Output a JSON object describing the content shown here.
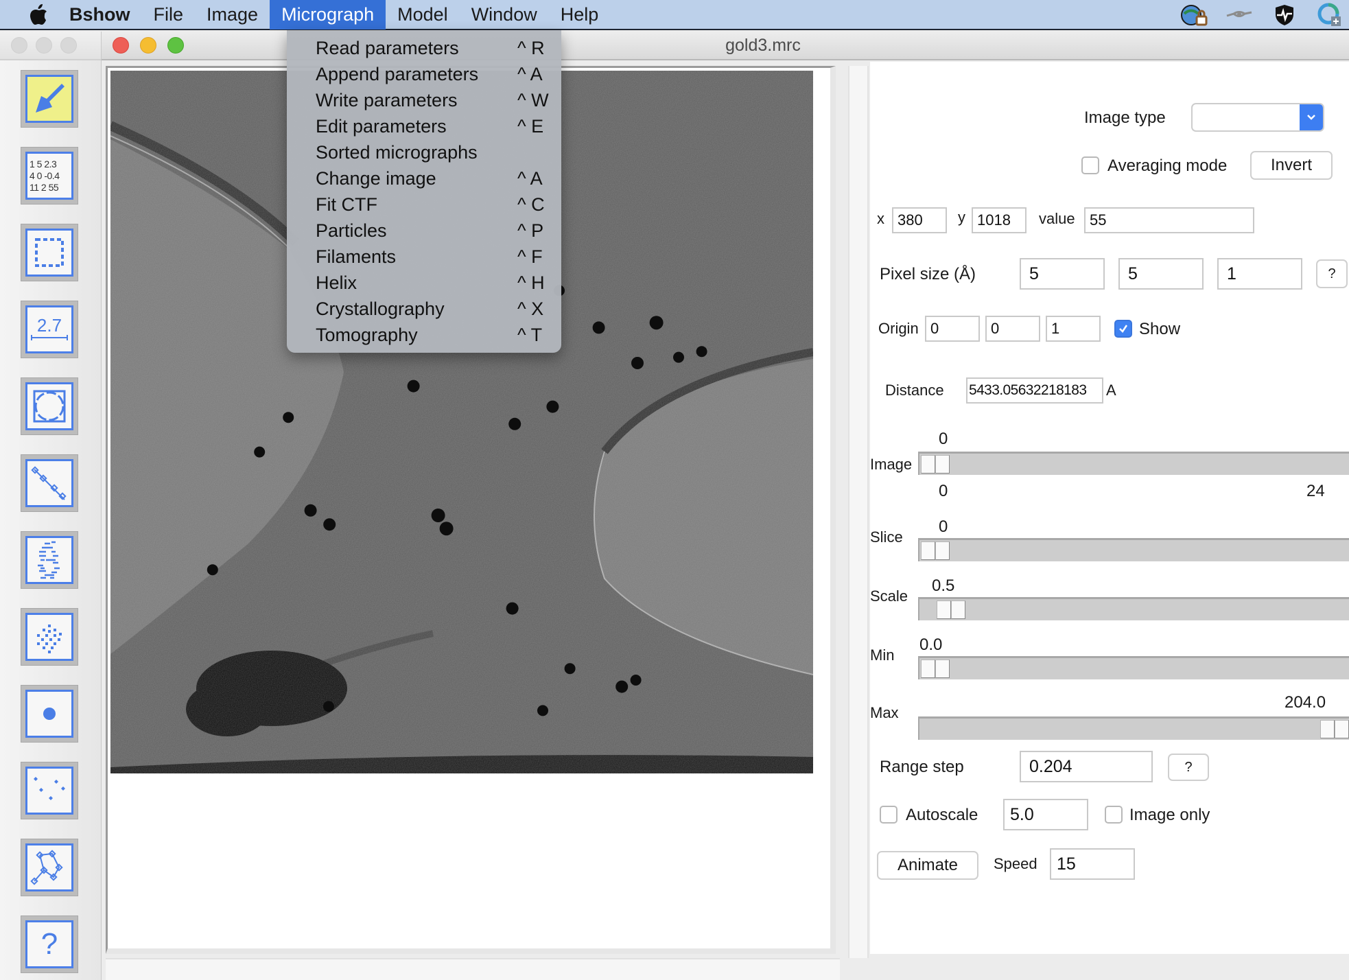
{
  "menubar": {
    "app_name": "Bshow",
    "items": [
      "File",
      "Image",
      "Micrograph",
      "Model",
      "Window",
      "Help"
    ],
    "active": "Micrograph",
    "status_icons": [
      "globe-lock-icon",
      "eye-icon",
      "shield-pulse-icon",
      "sync-plus-icon"
    ]
  },
  "micrograph_menu": {
    "items": [
      {
        "label": "Read parameters",
        "shortcut": "^ R"
      },
      {
        "label": "Append parameters",
        "shortcut": "^ A"
      },
      {
        "label": "Write parameters",
        "shortcut": "^ W"
      },
      {
        "label": "Edit parameters",
        "shortcut": "^ E"
      },
      {
        "label": "Sorted micrographs",
        "shortcut": ""
      },
      {
        "label": "Change image",
        "shortcut": "^ A"
      },
      {
        "label": "Fit CTF",
        "shortcut": "^ C"
      },
      {
        "label": "Particles",
        "shortcut": "^ P"
      },
      {
        "label": "Filaments",
        "shortcut": "^ F"
      },
      {
        "label": "Helix",
        "shortcut": "^ H"
      },
      {
        "label": "Crystallography",
        "shortcut": "^ X"
      },
      {
        "label": "Tomography",
        "shortcut": "^ T"
      }
    ]
  },
  "tools": {
    "items": [
      {
        "name": "pointer-tool",
        "icon": "arrow-pointer-icon",
        "selected": true
      },
      {
        "name": "values-tool",
        "icon": "number-grid-icon",
        "text_rows": [
          "1 5 2.3",
          "4 0 -0.4",
          "11 2 55"
        ]
      },
      {
        "name": "box-select-tool",
        "icon": "dashed-box-icon"
      },
      {
        "name": "measure-tool",
        "icon": "ruler-measure-icon",
        "text": "2.7"
      },
      {
        "name": "circle-tool",
        "icon": "circle-in-square-icon"
      },
      {
        "name": "filament-tool",
        "icon": "filament-line-icon"
      },
      {
        "name": "helix-tool",
        "icon": "helix-icon"
      },
      {
        "name": "lattice-tool",
        "icon": "lattice-dots-icon"
      },
      {
        "name": "particle-tool",
        "icon": "dot-icon"
      },
      {
        "name": "markers-tool",
        "icon": "scattered-points-icon"
      },
      {
        "name": "model-tool",
        "icon": "graph-network-icon"
      },
      {
        "name": "help-tool",
        "icon": "question-mark-icon",
        "text": "?"
      }
    ]
  },
  "window": {
    "title": "gold3.mrc"
  },
  "controls": {
    "image_type_label": "Image type",
    "image_type_value": "",
    "averaging_mode_label": "Averaging mode",
    "averaging_mode_checked": false,
    "invert_label": "Invert",
    "x_label": "x",
    "x_value": "380",
    "y_label": "y",
    "y_value": "1018",
    "value_label": "value",
    "value_value": "55",
    "pixel_size_label": "Pixel size (Å)",
    "pixel_size": [
      "5",
      "5",
      "1"
    ],
    "help_label": "?",
    "origin_label": "Origin",
    "origin": [
      "0",
      "0",
      "1"
    ],
    "show_label": "Show",
    "show_checked": true,
    "distance_label": "Distance",
    "distance_value": "5433.05632218183",
    "distance_unit": "A",
    "sliders": {
      "image": {
        "label": "Image",
        "value": "0",
        "min": "0",
        "max": "24",
        "fraction": 0.0
      },
      "slice": {
        "label": "Slice",
        "value": "0",
        "fraction": 0.0
      },
      "scale": {
        "label": "Scale",
        "value": "0.5",
        "fraction": 0.04
      },
      "min": {
        "label": "Min",
        "value": "0.0",
        "fraction": 0.0
      },
      "max": {
        "label": "Max",
        "value": "204.0",
        "fraction": 1.0
      }
    },
    "range_step_label": "Range step",
    "range_step_value": "0.204",
    "autoscale_label": "Autoscale",
    "autoscale_checked": false,
    "autoscale_value": "5.0",
    "image_only_label": "Image only",
    "image_only_checked": false,
    "animate_label": "Animate",
    "speed_label": "Speed",
    "speed_value": "15"
  }
}
